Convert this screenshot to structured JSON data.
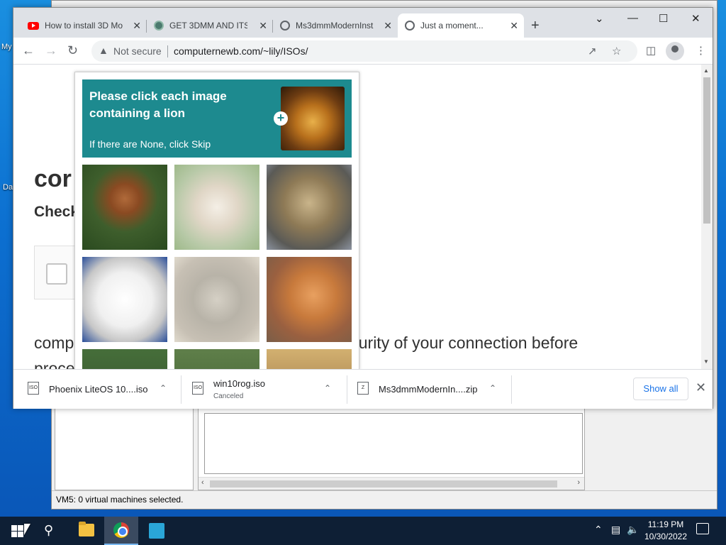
{
  "browser": {
    "tabs": [
      {
        "label": "How to install 3D Mo",
        "icon": "youtube-icon"
      },
      {
        "label": "GET 3DMM AND ITS",
        "icon": "site-icon"
      },
      {
        "label": "Ms3dmmModernInst",
        "icon": "globe-icon"
      },
      {
        "label": "Just a moment...",
        "icon": "globe-icon"
      }
    ],
    "security_label": "Not secure",
    "url": "computernewb.com/~lily/ISOs/"
  },
  "page": {
    "heading": "cor",
    "subheading": "Check",
    "paragraph_line1": "comp",
    "paragraph_security": "curity of your connection before",
    "paragraph_line2": "proce"
  },
  "captcha": {
    "prompt": "Please click each image containing a lion",
    "hint": "If there are None, click Skip",
    "plus_symbol": "+"
  },
  "downloads": [
    {
      "name": "Phoenix LiteOS 10....iso",
      "status": "",
      "icon_text": "ISO"
    },
    {
      "name": "win10rog.iso",
      "status": "Canceled",
      "icon_text": "ISO"
    },
    {
      "name": "Ms3dmmModernIn....zip",
      "status": "",
      "icon_text": "Z"
    }
  ],
  "show_all_label": "Show all",
  "background_app": {
    "status_text": "VM5:  0 virtual machines selected."
  },
  "desktop": {
    "icon_label_1": "My",
    "icon_label_2": "Da"
  },
  "taskbar": {
    "time": "11:19 PM",
    "date": "10/30/2022"
  },
  "colors": {
    "captcha_header": "#1d8a8f",
    "link_blue": "#1a73e8",
    "taskbar": "#0e1f35"
  }
}
